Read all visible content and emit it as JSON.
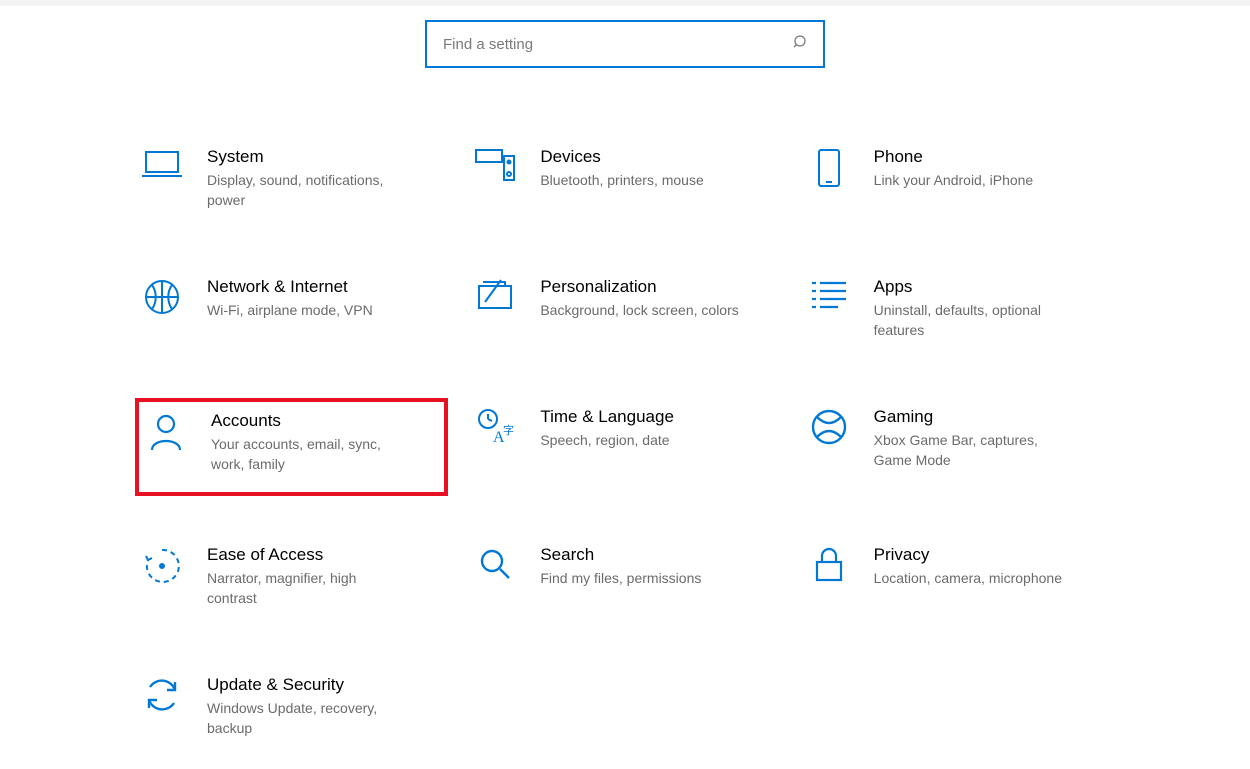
{
  "search": {
    "placeholder": "Find a setting"
  },
  "tiles": [
    {
      "key": "system",
      "title": "System",
      "desc": "Display, sound, notifications, power"
    },
    {
      "key": "devices",
      "title": "Devices",
      "desc": "Bluetooth, printers, mouse"
    },
    {
      "key": "phone",
      "title": "Phone",
      "desc": "Link your Android, iPhone"
    },
    {
      "key": "network",
      "title": "Network & Internet",
      "desc": "Wi-Fi, airplane mode, VPN"
    },
    {
      "key": "personalization",
      "title": "Personalization",
      "desc": "Background, lock screen, colors"
    },
    {
      "key": "apps",
      "title": "Apps",
      "desc": "Uninstall, defaults, optional features"
    },
    {
      "key": "accounts",
      "title": "Accounts",
      "desc": "Your accounts, email, sync, work, family",
      "highlight": true
    },
    {
      "key": "time-language",
      "title": "Time & Language",
      "desc": "Speech, region, date"
    },
    {
      "key": "gaming",
      "title": "Gaming",
      "desc": "Xbox Game Bar, captures, Game Mode"
    },
    {
      "key": "ease-of-access",
      "title": "Ease of Access",
      "desc": "Narrator, magnifier, high contrast"
    },
    {
      "key": "search",
      "title": "Search",
      "desc": "Find my files, permissions"
    },
    {
      "key": "privacy",
      "title": "Privacy",
      "desc": "Location, camera, microphone"
    },
    {
      "key": "update-security",
      "title": "Update & Security",
      "desc": "Windows Update, recovery, backup"
    }
  ]
}
